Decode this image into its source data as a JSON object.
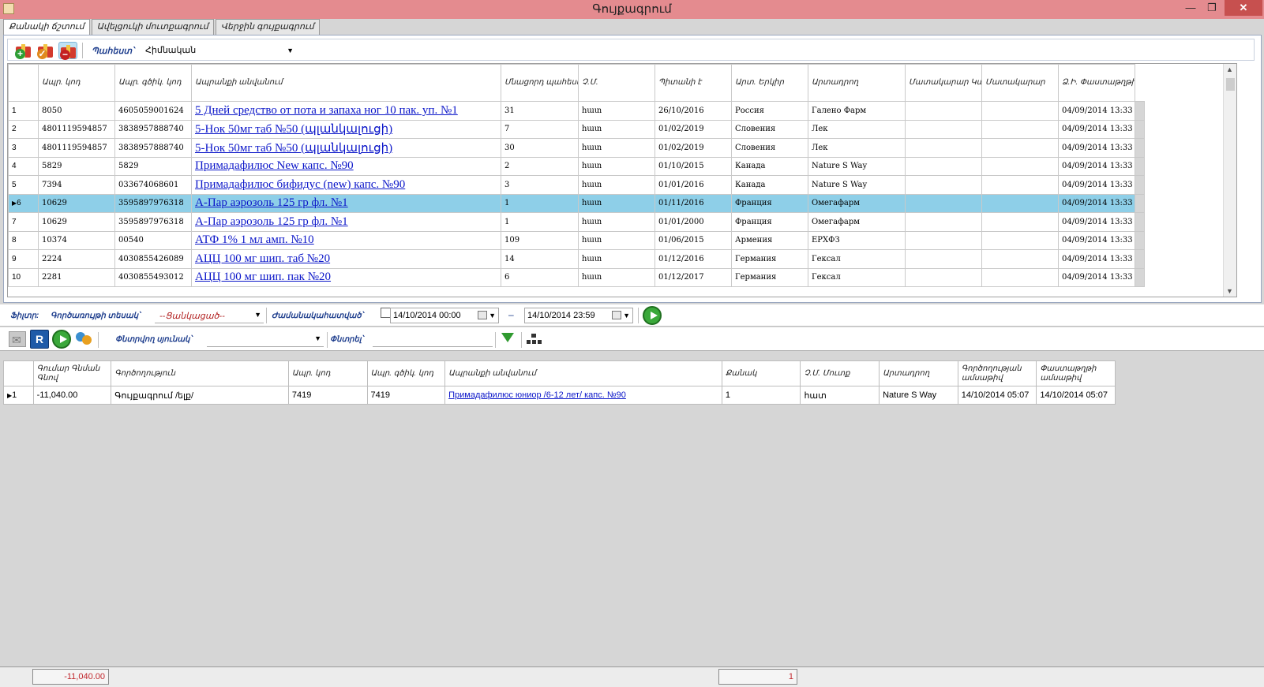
{
  "window": {
    "title": "Գույքագրում"
  },
  "tabs": [
    "Քանակի ճշտում",
    "Ավելցուկի մուտքագրում",
    "Վերջին գույքագրում"
  ],
  "toolbar1": {
    "type_label": "Պահեստ՝",
    "type_value": "Հիմնական"
  },
  "grid1": {
    "headers": [
      "Ապր. կոդ",
      "Ապր. գծիկ. կոդ",
      "Ապրանքի անվանում",
      "Մնացորդ պահեստում",
      "Չ.Մ.",
      "Պիտանի է",
      "Արտ. Երկիր",
      "Արտադրող",
      "Մատակարար Կազմ.Այլ անվանում",
      "Մատակարար",
      "Ձ.Ի. Փաստաթղթի Ամսաթիվ"
    ],
    "rows": [
      {
        "n": "1",
        "code": "8050",
        "barcode": "4605059001624",
        "name": "5 Дней средство от пота и запаха ног 10 пак. уп. №1",
        "stock": "31",
        "unit": "հատ",
        "expiry": "26/10/2016",
        "country": "Россия",
        "maker": "Галено Фарм",
        "alt": "",
        "supplier": "",
        "date": "04/09/2014 13:33"
      },
      {
        "n": "2",
        "code": "4801119594857",
        "barcode": "3838957888740",
        "name": "5-Нок 50мг таб №50 (պլանկալուցի)",
        "stock": "7",
        "unit": "հատ",
        "expiry": "01/02/2019",
        "country": "Словения",
        "maker": "Лек",
        "alt": "",
        "supplier": "",
        "date": "04/09/2014 13:33"
      },
      {
        "n": "3",
        "code": "4801119594857",
        "barcode": "3838957888740",
        "name": "5-Нок 50мг таб №50 (պլանկալուցի)",
        "stock": "30",
        "unit": "հատ",
        "expiry": "01/02/2019",
        "country": "Словения",
        "maker": "Лек",
        "alt": "",
        "supplier": "",
        "date": "04/09/2014 13:33"
      },
      {
        "n": "4",
        "code": "5829",
        "barcode": "5829",
        "name": "Примадафилюс New капс. №90",
        "stock": "2",
        "unit": "հատ",
        "expiry": "01/10/2015",
        "country": "Канада",
        "maker": "Nature S Way",
        "alt": "",
        "supplier": "",
        "date": "04/09/2014 13:33"
      },
      {
        "n": "5",
        "code": "7394",
        "barcode": "033674068601",
        "name": "Примадафилюс бифидус (new) капс. №90",
        "stock": "3",
        "unit": "հատ",
        "expiry": "01/01/2016",
        "country": "Канада",
        "maker": "Nature S Way",
        "alt": "",
        "supplier": "",
        "date": "04/09/2014 13:33"
      },
      {
        "n": "6",
        "code": "10629",
        "barcode": "3595897976318",
        "name": "А-Пар аэрозоль 125 гр фл. №1",
        "stock": "1",
        "unit": "հատ",
        "expiry": "01/11/2016",
        "country": "Франция",
        "maker": "Омегафарм",
        "alt": "",
        "supplier": "",
        "date": "04/09/2014 13:33"
      },
      {
        "n": "7",
        "code": "10629",
        "barcode": "3595897976318",
        "name": "А-Пар аэрозоль 125 гр фл. №1",
        "stock": "1",
        "unit": "հատ",
        "expiry": "01/01/2000",
        "country": "Франция",
        "maker": "Омегафарм",
        "alt": "",
        "supplier": "",
        "date": "04/09/2014 13:33"
      },
      {
        "n": "8",
        "code": "10374",
        "barcode": "00540",
        "name": "АТФ 1% 1 мл амп. №10",
        "stock": "109",
        "unit": "հատ",
        "expiry": "01/06/2015",
        "country": "Армения",
        "maker": "ЕРХФЗ",
        "alt": "",
        "supplier": "",
        "date": "04/09/2014 13:33"
      },
      {
        "n": "9",
        "code": "2224",
        "barcode": "4030855426089",
        "name": "АЦЦ 100 мг шип. таб №20",
        "stock": "14",
        "unit": "հատ",
        "expiry": "01/12/2016",
        "country": "Германия",
        "maker": "Гексал",
        "alt": "",
        "supplier": "",
        "date": "04/09/2014 13:33"
      },
      {
        "n": "10",
        "code": "2281",
        "barcode": "4030855493012",
        "name": "АЦЦ 100 мг шип. пак №20",
        "stock": "6",
        "unit": "հատ",
        "expiry": "01/12/2017",
        "country": "Германия",
        "maker": "Гексал",
        "alt": "",
        "supplier": "",
        "date": "04/09/2014 13:33"
      }
    ],
    "selected_row": "6"
  },
  "filterbar": {
    "filter_label": "Ֆիլտր:",
    "op_type_label": "Գործառույթի տեսակ՝",
    "op_type_value": "--Ցանկացած--",
    "period_label": "Ժամանակահատված՝",
    "from": "14/10/2014 00:00",
    "dash": "–",
    "to": "14/10/2014 23:59"
  },
  "toolbar2": {
    "search_column_label": "Փնտրվող սյունակ՝",
    "search_label": "Փնտրել՝"
  },
  "grid2": {
    "headers": [
      "Գումար Գնման Գնով",
      "Գործողություն",
      "Ապր. կոդ",
      "Ապր. գծիկ. կոդ",
      "Ապրանքի անվանում",
      "Քանակ",
      "Չ.Մ. Մուտք",
      "Արտադրող",
      "Գործողության ամսաթիվ",
      "Փաստաթղթի ամսաթիվ"
    ],
    "rows": [
      {
        "n": "1",
        "sum": "-11,040.00",
        "action": "Գույքագրում /ելք/",
        "code": "7419",
        "barcode": "7419",
        "name": "Примадафилюс юниор /6-12 лет/ капс. №90",
        "qty": "1",
        "unit": "հատ",
        "maker": "Nature S Way",
        "opdate": "14/10/2014 05:07",
        "docdate": "14/10/2014 05:07"
      }
    ]
  },
  "footer": {
    "sum_total": "-11,040.00",
    "qty_total": "1"
  }
}
